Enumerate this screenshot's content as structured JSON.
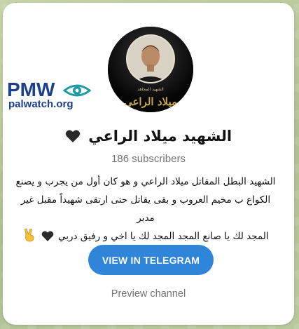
{
  "channel": {
    "title": "الشهيد ميلاد الراعي",
    "title_emoji": "black-heart",
    "subscribers": "186 subscribers",
    "description": [
      "الشهيد البطل المقاتل ميلاد الراعي و هو كان أول من يجرب و يصنع",
      "الكواع ب مخيم العروب و بقى يقاتل حتى ارتقى شهيداً مقبل غير مدبر",
      "المجد لك يا صانع المجد المجد لك يا اخي و رفيق دربي"
    ],
    "description_emojis": [
      "black-heart",
      "victory-hand"
    ],
    "avatar": {
      "caption_small": "الشهيد المجاهد",
      "caption_large": "ميلاد الراعي"
    }
  },
  "actions": {
    "view_label": "VIEW IN TELEGRAM",
    "preview_label": "Preview channel"
  },
  "watermark": {
    "brand": "PMW",
    "site": "palwatch.org"
  },
  "colors": {
    "button": "#2f85d9",
    "muted_text": "#707579",
    "brand_blue": "#1c3f8e",
    "brand_teal": "#1e9ba0"
  }
}
